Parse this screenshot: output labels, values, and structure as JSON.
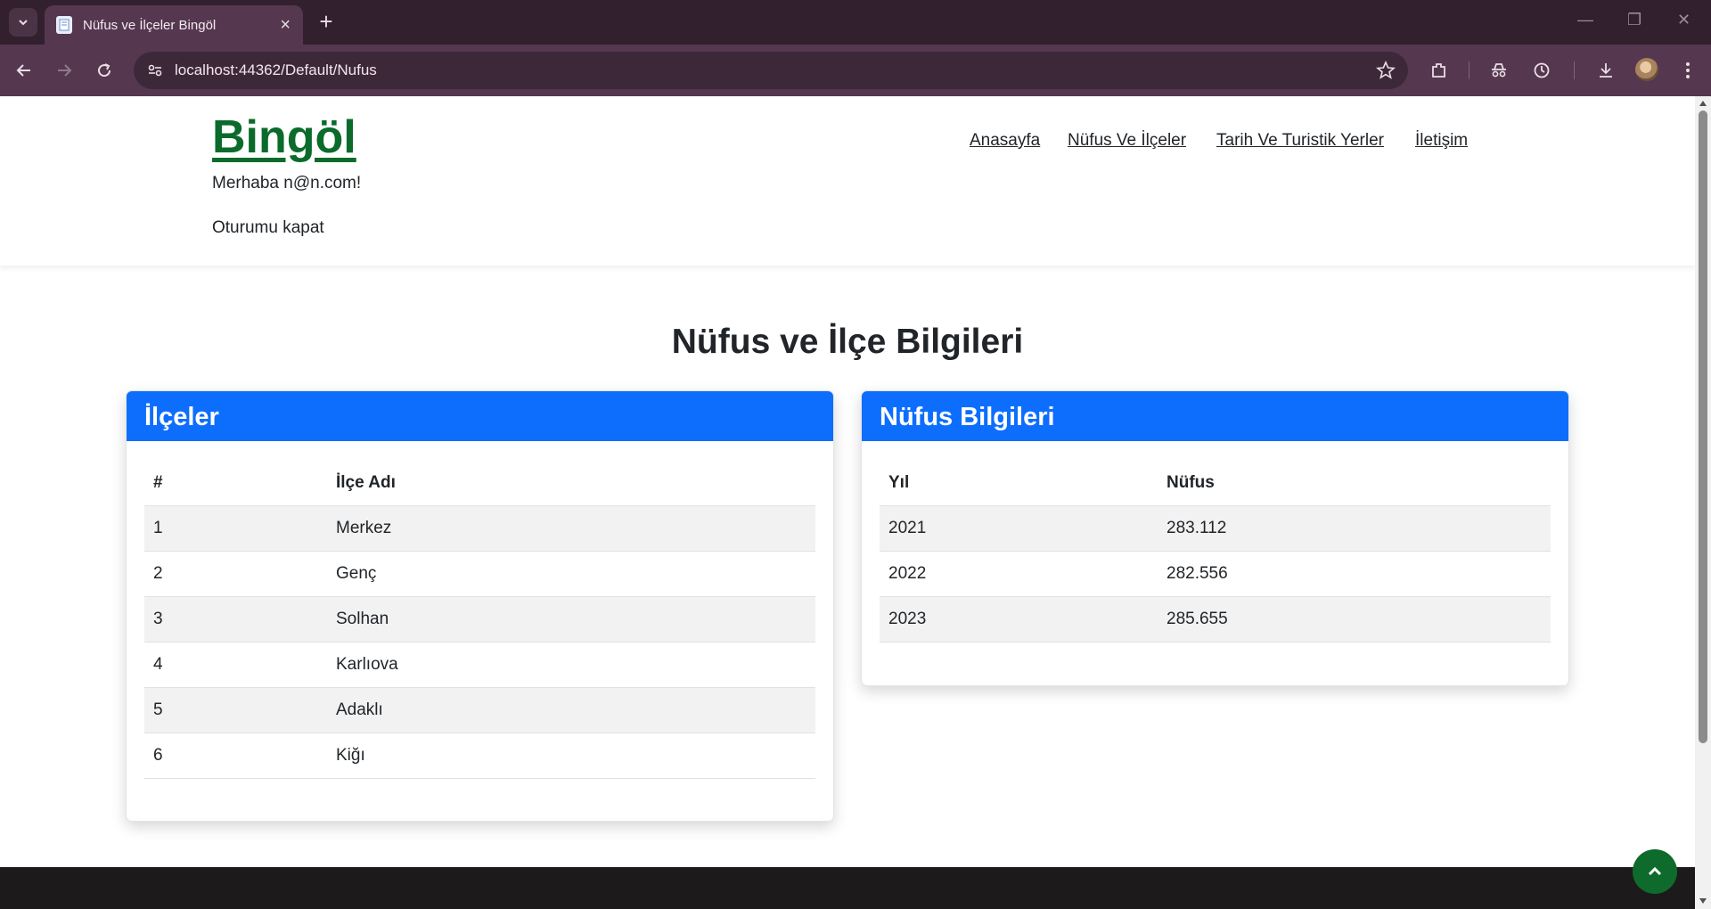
{
  "browser": {
    "tab_title": "Nüfus ve İlçeler Bingöl",
    "url": "localhost:44362/Default/Nufus"
  },
  "site": {
    "brand": "Bingöl",
    "greeting": "Merhaba n@n.com!",
    "logout": "Oturumu kapat",
    "nav": [
      "Anasayfa",
      "Nüfus Ve İlçeler",
      "Tarih Ve Turistik Yerler",
      "İletişim"
    ]
  },
  "page": {
    "title": "Nüfus ve İlçe Bilgileri"
  },
  "districts": {
    "title": "İlçeler",
    "columns": [
      "#",
      "İlçe Adı"
    ],
    "rows": [
      [
        "1",
        "Merkez"
      ],
      [
        "2",
        "Genç"
      ],
      [
        "3",
        "Solhan"
      ],
      [
        "4",
        "Karlıova"
      ],
      [
        "5",
        "Adaklı"
      ],
      [
        "6",
        "Kiğı"
      ]
    ]
  },
  "population": {
    "title": "Nüfus Bilgileri",
    "columns": [
      "Yıl",
      "Nüfus"
    ],
    "rows": [
      [
        "2021",
        "283.112"
      ],
      [
        "2022",
        "282.556"
      ],
      [
        "2023",
        "285.655"
      ]
    ]
  }
}
